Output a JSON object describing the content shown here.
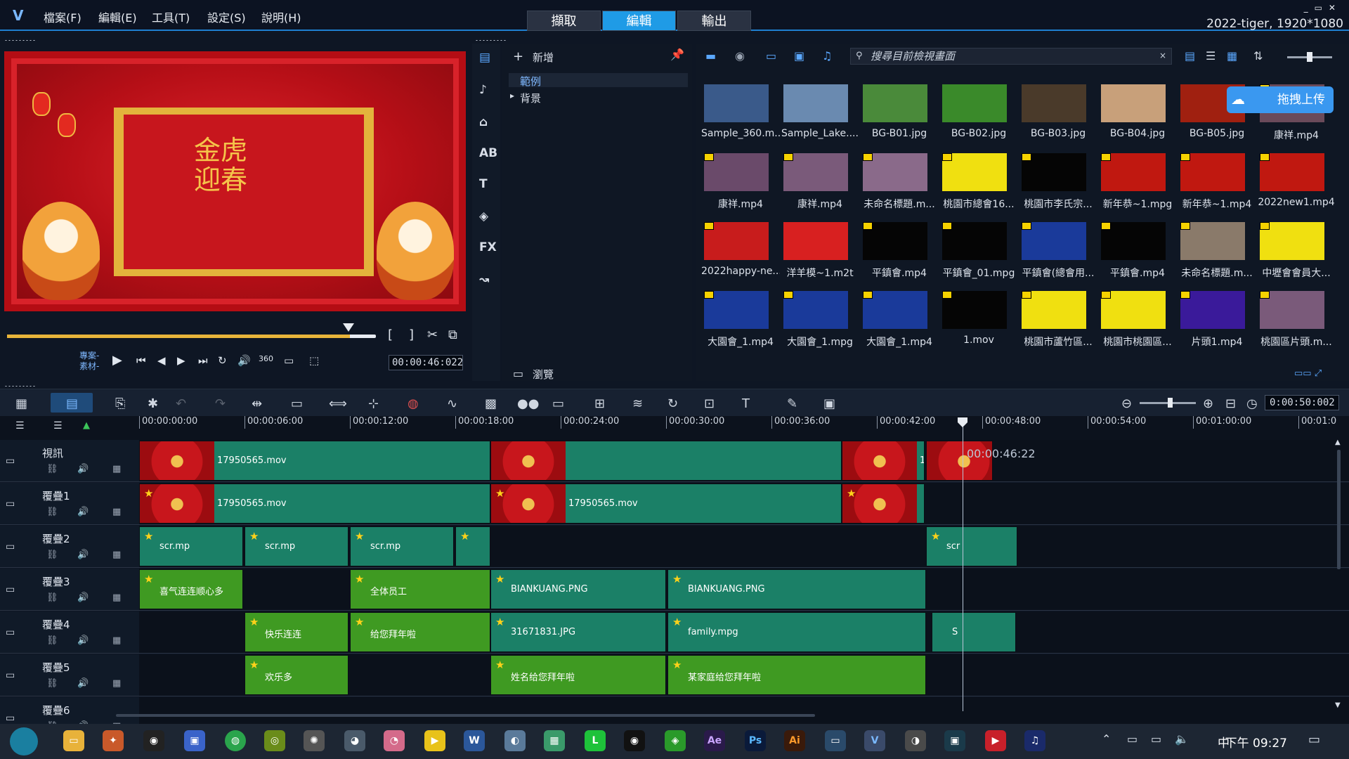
{
  "menubar": {
    "items": [
      "檔案(F)",
      "編輯(E)",
      "工具(T)",
      "設定(S)",
      "說明(H)"
    ],
    "tabs": [
      "擷取",
      "編輯",
      "輸出"
    ],
    "active_tab": "編輯",
    "project_info": "2022-tiger, 1920*1080"
  },
  "preview": {
    "title_chars": "金虎迎春",
    "project_label": "專案",
    "clip_label": "素材",
    "timecode": "00:00:46:022",
    "scrub_position_fraction": 0.93
  },
  "library": {
    "add_label": "新增",
    "tree": [
      {
        "label": "範例",
        "selected": true
      },
      {
        "label": "背景",
        "selected": false
      }
    ],
    "browse_label": "瀏覽",
    "search_placeholder": "搜尋目前檢視畫面",
    "upload_label": "拖拽上传",
    "thumbnails": [
      "Sample_360.m...",
      "Sample_Lake....",
      "BG-B01.jpg",
      "BG-B02.jpg",
      "BG-B03.jpg",
      "BG-B04.jpg",
      "BG-B05.jpg",
      "康祥.mp4",
      "康祥.mp4",
      "康祥.mp4",
      "未命名標題.m...",
      "桃園市總會16...",
      "桃園市李氏宗...",
      "新年恭~1.mpg",
      "新年恭~1.mp4",
      "2022new1.mp4",
      "2022happy-ne...",
      "洋羊模~1.m2t",
      "平鎮會.mp4",
      "平鎮會_01.mpg",
      "平鎮會(總會用...",
      "平鎮會.mp4",
      "未命名標題.m...",
      "中壢會會員大...",
      "大園會_1.mp4",
      "大園會_1.mpg",
      "大園會_1.mp4",
      "1.mov",
      "桃園市蘆竹區...",
      "桃園市桃園區...",
      "片頭1.mp4",
      "桃園區片頭.m..."
    ]
  },
  "timeline": {
    "timecode": "0:00:50:002",
    "playhead_time": "00:00:46:22",
    "ruler": [
      "00:00:00:00",
      "00:00:06:00",
      "00:00:12:00",
      "00:00:18:00",
      "00:00:24:00",
      "00:00:30:00",
      "00:00:36:00",
      "00:00:42:00",
      "00:00:48:00",
      "00:00:54:00",
      "00:01:00:00",
      "00:01:0"
    ],
    "tracks": [
      {
        "name": "視訊",
        "clips": [
          "17950565.mov",
          "17950565.mov"
        ]
      },
      {
        "name": "覆疊1",
        "clips": [
          "17950565.mov",
          "17950565.mov"
        ]
      },
      {
        "name": "覆疊2",
        "clips": [
          "scr.mp",
          "scr.mp",
          "scr.mp",
          "scr"
        ]
      },
      {
        "name": "覆疊3",
        "clips": [
          "喜气连连顺心多",
          "全体员工",
          "BIANKUANG.PNG",
          "BIANKUANG.PNG"
        ]
      },
      {
        "name": "覆疊4",
        "clips": [
          "快乐连连",
          "给您拜年啦",
          "31671831.JPG",
          "family.mpg",
          "S"
        ]
      },
      {
        "name": "覆疊5",
        "clips": [
          "欢乐多",
          "姓名给您拜年啦",
          "某家庭给您拜年啦"
        ]
      },
      {
        "name": "覆疊6"
      }
    ]
  },
  "taskbar": {
    "ime": "中",
    "clock": "下午 09:27"
  },
  "colors": {
    "accent": "#1f9be6",
    "video_clip": "#1b8067",
    "title_clip": "#3f9a22"
  }
}
